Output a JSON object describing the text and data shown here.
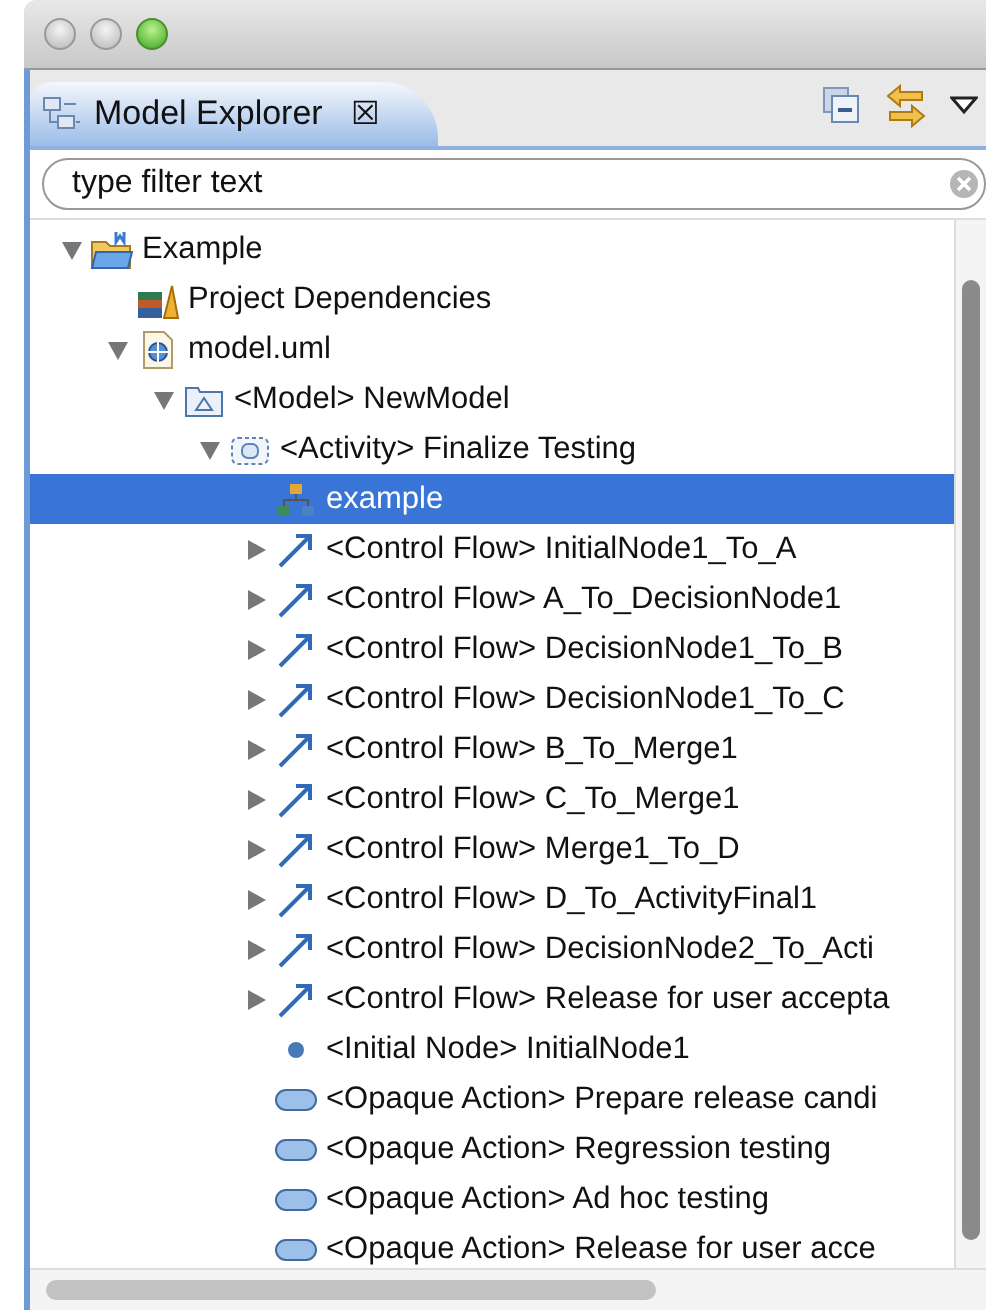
{
  "view": {
    "title": "Model Explorer",
    "close": "☒"
  },
  "filter": {
    "placeholder": "type filter text"
  },
  "tree": [
    {
      "label": "Example",
      "kind": "project",
      "expanded": true,
      "selected": false,
      "children": [
        {
          "label": "Project Dependencies",
          "kind": "deps",
          "selected": false
        },
        {
          "label": "model.uml",
          "kind": "file",
          "expanded": true,
          "selected": false,
          "children": [
            {
              "label": "<Model> NewModel",
              "kind": "model",
              "expanded": true,
              "selected": false,
              "children": [
                {
                  "label": "<Activity> Finalize Testing",
                  "kind": "activity",
                  "expanded": true,
                  "selected": false,
                  "children": [
                    {
                      "label": "example",
                      "kind": "diagram",
                      "selected": true
                    },
                    {
                      "label": "<Control Flow> InitialNode1_To_A",
                      "kind": "flow",
                      "expanded": false,
                      "selected": false
                    },
                    {
                      "label": "<Control Flow> A_To_DecisionNode1",
                      "kind": "flow",
                      "expanded": false,
                      "selected": false
                    },
                    {
                      "label": "<Control Flow> DecisionNode1_To_B",
                      "kind": "flow",
                      "expanded": false,
                      "selected": false
                    },
                    {
                      "label": "<Control Flow> DecisionNode1_To_C",
                      "kind": "flow",
                      "expanded": false,
                      "selected": false
                    },
                    {
                      "label": "<Control Flow> B_To_Merge1",
                      "kind": "flow",
                      "expanded": false,
                      "selected": false
                    },
                    {
                      "label": "<Control Flow> C_To_Merge1",
                      "kind": "flow",
                      "expanded": false,
                      "selected": false
                    },
                    {
                      "label": "<Control Flow> Merge1_To_D",
                      "kind": "flow",
                      "expanded": false,
                      "selected": false
                    },
                    {
                      "label": "<Control Flow> D_To_ActivityFinal1",
                      "kind": "flow",
                      "expanded": false,
                      "selected": false
                    },
                    {
                      "label": "<Control Flow> DecisionNode2_To_Acti",
                      "kind": "flow",
                      "expanded": false,
                      "selected": false
                    },
                    {
                      "label": "<Control Flow> Release for user accepta",
                      "kind": "flow",
                      "expanded": false,
                      "selected": false
                    },
                    {
                      "label": "<Initial Node> InitialNode1",
                      "kind": "initial",
                      "selected": false
                    },
                    {
                      "label": "<Opaque Action> Prepare release candi",
                      "kind": "action",
                      "selected": false
                    },
                    {
                      "label": "<Opaque Action> Regression testing",
                      "kind": "action",
                      "selected": false
                    },
                    {
                      "label": "<Opaque Action> Ad hoc testing",
                      "kind": "action",
                      "selected": false
                    },
                    {
                      "label": "<Opaque Action> Release for user acce",
                      "kind": "action",
                      "selected": false
                    }
                  ]
                }
              ]
            }
          ]
        }
      ]
    }
  ]
}
